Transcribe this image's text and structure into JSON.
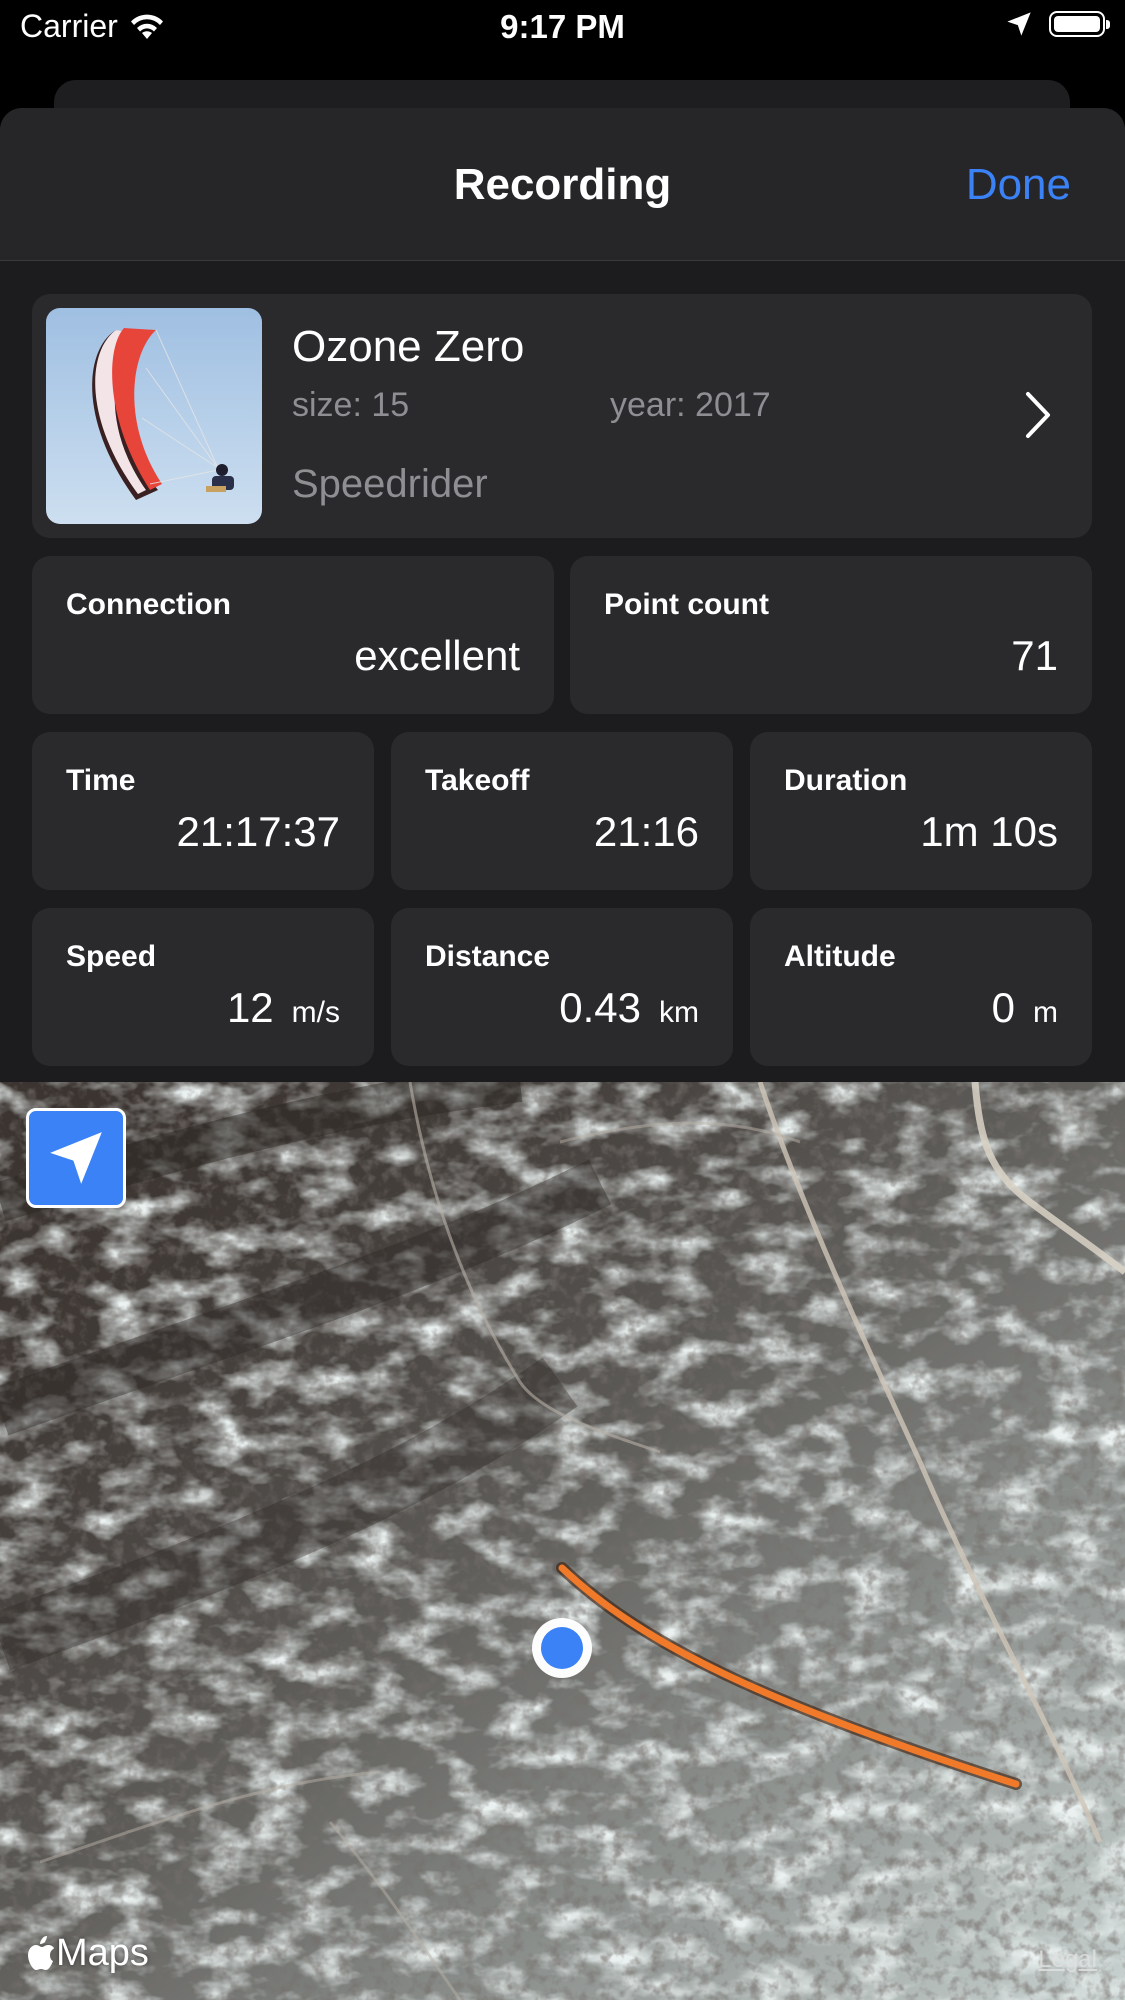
{
  "status_bar": {
    "carrier": "Carrier",
    "time": "9:17 PM",
    "icons": [
      "wifi-icon",
      "location-arrow-icon",
      "battery-icon"
    ]
  },
  "nav": {
    "title": "Recording",
    "done_label": "Done"
  },
  "glider": {
    "name": "Ozone Zero",
    "size": "size: 15",
    "year": "year: 2017",
    "type": "Speedrider",
    "icon": "chevron-right-icon"
  },
  "stats": {
    "connection": {
      "label": "Connection",
      "value": "excellent"
    },
    "point_count": {
      "label": "Point count",
      "value": "71"
    },
    "time": {
      "label": "Time",
      "value": "21:17:37"
    },
    "takeoff": {
      "label": "Takeoff",
      "value": "21:16"
    },
    "duration": {
      "label": "Duration",
      "value": "1m 10s"
    },
    "speed": {
      "label": "Speed",
      "value": "12",
      "unit": "m/s"
    },
    "distance": {
      "label": "Distance",
      "value": "0.43",
      "unit": "km"
    },
    "altitude": {
      "label": "Altitude",
      "value": "0",
      "unit": "m"
    }
  },
  "map": {
    "brand": "Maps",
    "legal": "Legal",
    "track_color": "#f07a2a",
    "position_color": "#3b82f6"
  },
  "colors": {
    "accent": "#3b82f6",
    "card": "#2a2a2d",
    "sheet": "#1c1c1e"
  }
}
